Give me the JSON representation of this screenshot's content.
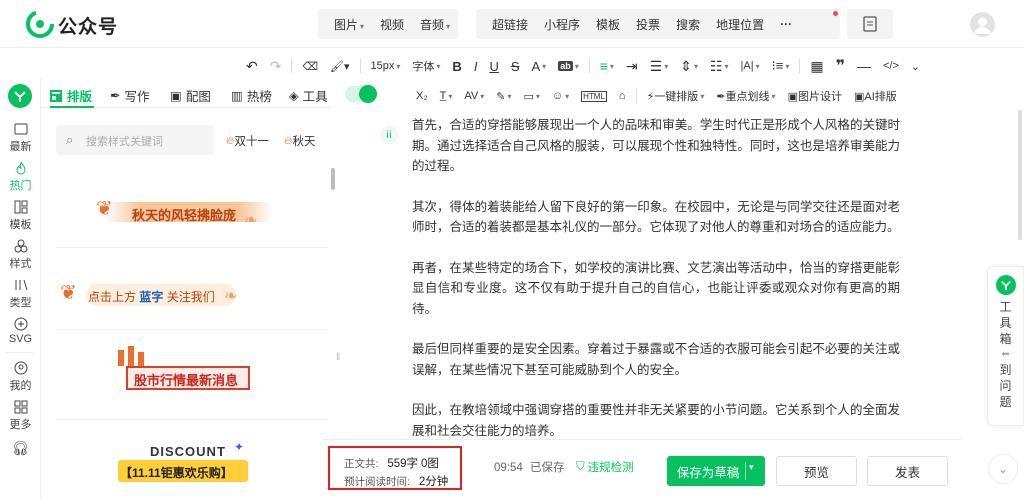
{
  "app": {
    "title": "公众号"
  },
  "topbar": {
    "insert_group": [
      "图片",
      "视频",
      "音频"
    ],
    "feature_group": [
      "超链接",
      "小程序",
      "模板",
      "投票",
      "搜索",
      "地理位置"
    ],
    "more_label": "···"
  },
  "toolbar": {
    "font_size": "15px",
    "font_family": "字体",
    "one_click_layout": "一键排版",
    "highlight": "重点划线",
    "image_design": "图片设计",
    "ai_layout": "AI排版"
  },
  "rail": {
    "items": [
      {
        "label": "最新",
        "icon": "image-icon"
      },
      {
        "label": "热门",
        "icon": "flame-icon",
        "active": true
      },
      {
        "label": "模板",
        "icon": "template-icon"
      },
      {
        "label": "样式",
        "icon": "style-icon"
      },
      {
        "label": "类型",
        "icon": "type-icon"
      },
      {
        "label": "SVG",
        "icon": "svg-icon"
      },
      {
        "label": "我的",
        "icon": "user-icon"
      },
      {
        "label": "更多",
        "icon": "grid-icon"
      }
    ]
  },
  "panel": {
    "tabs": [
      "排版",
      "写作",
      "配图",
      "热榜",
      "工具"
    ],
    "search_placeholder": "搜索样式关键词",
    "hot_tags": [
      "双十一",
      "秋天"
    ],
    "cards": [
      {
        "text": "秋天的风轻拂脸庞"
      },
      {
        "text_parts": [
          "点击上方",
          "蓝字",
          "关注我们"
        ]
      },
      {
        "text": "股市行情最新消息"
      },
      {
        "title": "DISCOUNT",
        "text": "【11.11钜惠欢乐购】"
      }
    ]
  },
  "editor": {
    "paragraphs": [
      "首先，合适的穿搭能够展现出一个人的品味和审美。学生时代正是形成个人风格的关键时期。通过选择适合自己风格的服装，可以展现个性和独特性。同时，这也是培养审美能力的过程。",
      "其次，得体的着装能给人留下良好的第一印象。在校园中，无论是与同学交往还是面对老师时，合适的着装都是基本礼仪的一部分。它体现了对他人的尊重和对场合的适应能力。",
      "再者，在某些特定的场合下，如学校的演讲比赛、文艺演出等活动中，恰当的穿搭更能彰显自信和专业度。这不仅有助于提升自己的自信心，也能让评委或观众对你有更高的期待。",
      "最后但同样重要的是安全因素。穿着过于暴露或不合适的衣服可能会引起不必要的关注或误解，在某些情况下甚至可能威胁到个人的安全。",
      "因此，在教培领域中强调穿搭的重要性并非无关紧要的小节问题。它关系到个人的全面发展和社会交往能力的培养。"
    ]
  },
  "bottom": {
    "body_label": "正文共:",
    "word_count": "559字",
    "image_count": "0图",
    "read_label": "预计阅读时间:",
    "read_time": "2分钟",
    "save_time": "09:54",
    "save_status": "已保存",
    "violation_check": "违规检测",
    "save_draft": "保存为草稿",
    "preview": "预览",
    "publish": "发表"
  },
  "right_tools": {
    "toolbox_label": "工具箱",
    "to_issue_label": "到问题"
  },
  "colors": {
    "accent": "#07c160",
    "highlight_box": "#e02020",
    "autumn": "#e8702a"
  }
}
